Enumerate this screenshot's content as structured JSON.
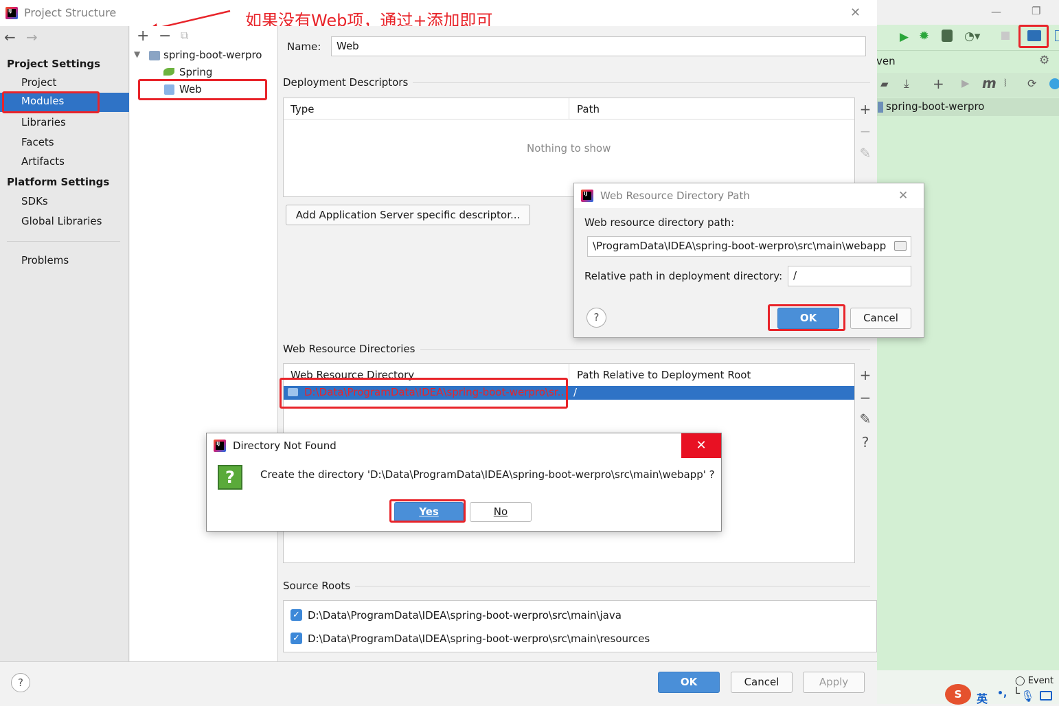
{
  "annotation": {
    "text": "如果没有Web项，通过+添加即可"
  },
  "window": {
    "title": "Project Structure",
    "close": "✕"
  },
  "nav": {
    "back": "←",
    "forward": "→",
    "project_settings_header": "Project Settings",
    "project_settings": [
      "Project",
      "Modules",
      "Libraries",
      "Facets",
      "Artifacts"
    ],
    "platform_settings_header": "Platform Settings",
    "platform_settings": [
      "SDKs",
      "Global Libraries"
    ],
    "problems": "Problems"
  },
  "tree": {
    "add": "+",
    "remove": "−",
    "copy": "⧉",
    "root": "spring-boot-werpro",
    "children": [
      "Spring",
      "Web"
    ]
  },
  "content": {
    "name_label": "Name:",
    "name_value": "Web",
    "deployment_descriptors": "Deployment Descriptors",
    "dd_columns": [
      "Type",
      "Path"
    ],
    "empty": "Nothing to show",
    "add_descriptor_button": "Add Application Server specific descriptor...",
    "web_resource_dirs": "Web Resource Directories",
    "wrd_columns": [
      "Web Resource Directory",
      "Path Relative to Deployment Root"
    ],
    "wrd_rows": [
      {
        "dir": "D:\\Data\\ProgramData\\IDEA\\spring-boot-werpro\\sr...",
        "rel": "/"
      }
    ],
    "source_roots": "Source Roots",
    "source_root_items": [
      "D:\\Data\\ProgramData\\IDEA\\spring-boot-werpro\\src\\main\\java",
      "D:\\Data\\ProgramData\\IDEA\\spring-boot-werpro\\src\\main\\resources"
    ]
  },
  "side_buttons": {
    "add": "+",
    "remove": "−",
    "edit": "✎",
    "help": "?"
  },
  "bottom": {
    "help": "?",
    "ok": "OK",
    "cancel": "Cancel",
    "apply": "Apply"
  },
  "web_dialog": {
    "title": "Web Resource Directory Path",
    "path_label": "Web resource directory path:",
    "path_value": "\\ProgramData\\IDEA\\spring-boot-werpro\\src\\main\\webapp",
    "relative_label": "Relative path in deployment directory:",
    "relative_value": "/",
    "help": "?",
    "ok": "OK",
    "cancel": "Cancel",
    "close": "✕"
  },
  "dir_dialog": {
    "title": "Directory Not Found",
    "message": "Create the directory 'D:\\Data\\ProgramData\\IDEA\\spring-boot-werpro\\src\\main\\webapp' ?",
    "yes": "Yes",
    "no": "No",
    "close": "✕",
    "question_mark": "?"
  },
  "ide": {
    "maven_label": "ven",
    "project": "spring-boot-werpro",
    "event_log": "Event L",
    "ime_lang": "英",
    "ime_punct": "•,",
    "minimize": "—",
    "restore": "❐"
  },
  "colors": {
    "accent": "#3b7dc4",
    "selection": "#2f73c6",
    "annotation_red": "#e8242a",
    "ide_green": "#d3efd3"
  }
}
